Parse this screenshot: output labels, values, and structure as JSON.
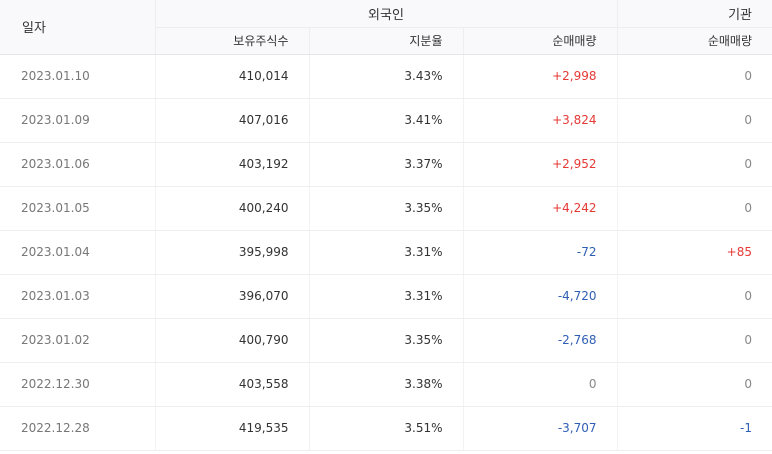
{
  "headers": {
    "date": "일자",
    "foreign": "외국인",
    "institution": "기관",
    "holdings": "보유주식수",
    "ratio": "지분율",
    "foreign_net": "순매매량",
    "institution_net": "순매매량"
  },
  "rows": [
    {
      "date": "2023.01.10",
      "holdings": "410,014",
      "ratio": "3.43%",
      "foreign_net": "+2,998",
      "institution_net": "0"
    },
    {
      "date": "2023.01.09",
      "holdings": "407,016",
      "ratio": "3.41%",
      "foreign_net": "+3,824",
      "institution_net": "0"
    },
    {
      "date": "2023.01.06",
      "holdings": "403,192",
      "ratio": "3.37%",
      "foreign_net": "+2,952",
      "institution_net": "0"
    },
    {
      "date": "2023.01.05",
      "holdings": "400,240",
      "ratio": "3.35%",
      "foreign_net": "+4,242",
      "institution_net": "0"
    },
    {
      "date": "2023.01.04",
      "holdings": "395,998",
      "ratio": "3.31%",
      "foreign_net": "-72",
      "institution_net": "+85"
    },
    {
      "date": "2023.01.03",
      "holdings": "396,070",
      "ratio": "3.31%",
      "foreign_net": "-4,720",
      "institution_net": "0"
    },
    {
      "date": "2023.01.02",
      "holdings": "400,790",
      "ratio": "3.35%",
      "foreign_net": "-2,768",
      "institution_net": "0"
    },
    {
      "date": "2022.12.30",
      "holdings": "403,558",
      "ratio": "3.38%",
      "foreign_net": "0",
      "institution_net": "0"
    },
    {
      "date": "2022.12.28",
      "holdings": "419,535",
      "ratio": "3.51%",
      "foreign_net": "-3,707",
      "institution_net": "-1"
    }
  ],
  "colors": {
    "positive": "#e53935",
    "negative": "#2f5fb3",
    "neutral": "#888888"
  }
}
